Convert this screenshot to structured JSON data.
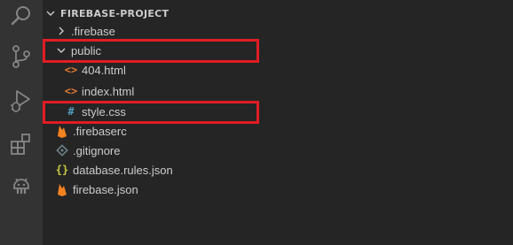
{
  "colors": {
    "activity_bg": "#333333",
    "explorer_bg": "#252526",
    "text": "#cccccc",
    "icon_gray": "#858585",
    "html_icon": "#e37933",
    "css_icon": "#519aba",
    "json_icon": "#cbcb41",
    "firebase_orange": "#f58220",
    "highlight": "#e21c23"
  },
  "activity_bar": {
    "icons": [
      "search-icon",
      "source-control-icon",
      "run-debug-icon",
      "extensions-icon",
      "android-icon"
    ]
  },
  "explorer": {
    "project_title": "FIREBASE-PROJECT",
    "items": [
      {
        "label": ".firebase",
        "type": "folder",
        "expanded": false
      },
      {
        "label": "public",
        "type": "folder",
        "expanded": true,
        "highlighted": true
      },
      {
        "label": "404.html",
        "type": "html-file"
      },
      {
        "label": "index.html",
        "type": "html-file"
      },
      {
        "label": "style.css",
        "type": "css-file",
        "icon_glyph": "#",
        "highlighted": true
      },
      {
        "label": ".firebaserc",
        "type": "firebase-file"
      },
      {
        "label": ".gitignore",
        "type": "git-file"
      },
      {
        "label": "database.rules.json",
        "type": "json-file",
        "icon_glyph": "{}"
      },
      {
        "label": "firebase.json",
        "type": "firebase-file"
      }
    ]
  }
}
